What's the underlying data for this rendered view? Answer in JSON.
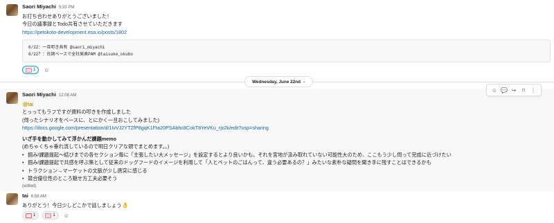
{
  "messages": [
    {
      "author": "Saori Miyachi",
      "time": "5:33 PM",
      "lines": [
        "お打ち合わせありがとうございました！",
        "今日の議事録とTodo共有させていただきます"
      ],
      "link": "https://petokoto-development.esa.io/posts/1802",
      "code_lines": [
        "6/22：一旦叩き共有 @saori_miyachi",
        "6/22？：台詞ベースで全社発表PAM @taisuke_okubo"
      ],
      "reactions": [
        {
          "icon": "pink-stamp-icon",
          "count": "1"
        }
      ]
    },
    {
      "author": "Saori Miyachi",
      "time": "12:08 AM",
      "mention": "@tai",
      "lines": [
        "とっってもラフですが資料の叩きを作成しました",
        "(伺ったシナリオをベースに、とにかく一旦おこしてみました)"
      ],
      "link": "https://docs.google.com/presentation/d/1IvVJ2YTZfP8gqK1Fta20PSAbhc8CokT8YeVKu_rjx2k/edit?usp=sharing",
      "heading": "いざ手を動かしてみて浮かんだ課題memo",
      "subheading": "(めちゃくちゃ垂れ流しているので明日クリアな頭でまとめます。。)",
      "bullets": [
        "掴み/課題提起〜結びまでの各セクション毎に「主張したい大メッセージ」を設定するとより良いかも。それを宮地が汲み取れていない可能性大のため、ここもう少し伺って完成に近づけたい",
        "掴み/課題提起で共感を呼ぶ策として従来のドッグフードのイメージを利用して「人とペットのごはんって、違う必要あるの？」みたいな素朴な疑問を聞き手に残すことはできるかも",
        "トラクション→マーケットの文脈が少し唐突に感じる",
        "競合優位性のところ魅せ方工夫必要そう"
      ],
      "edited": "(edited)"
    },
    {
      "author": "tai",
      "time": "6:58 AM",
      "lines": [
        "ありがとう！今日少しどこかで話しましょう"
      ],
      "reactions": [
        {
          "icon": "red-stamp-icon",
          "count": "1"
        },
        {
          "icon": "pink-stamp-icon",
          "count": "1"
        }
      ]
    }
  ],
  "date_divider": "Wednesday, June 22nd",
  "colors": {
    "link": "#1264a3",
    "mention_bg": "#fdf3d8",
    "reaction_border": "#1d9bd1"
  }
}
